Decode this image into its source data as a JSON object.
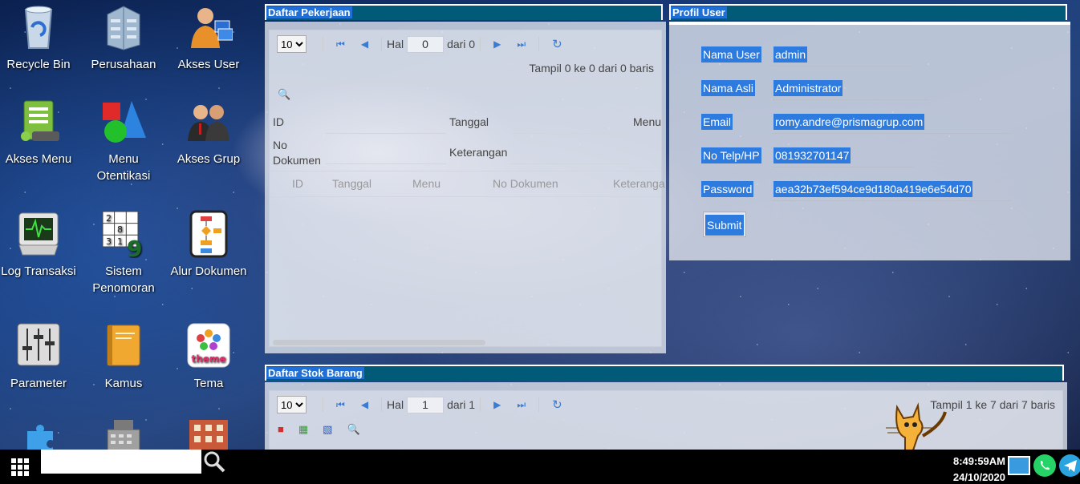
{
  "desktop": {
    "icons": [
      {
        "label": "Recycle Bin",
        "icon": "recycle-bin-icon"
      },
      {
        "label": "Perusahaan",
        "icon": "building-icon"
      },
      {
        "label": "Akses User",
        "icon": "user-access-icon"
      },
      {
        "label": "Akses Menu",
        "icon": "menu-access-icon"
      },
      {
        "label": "Menu Otentikasi",
        "icon": "shapes-icon"
      },
      {
        "label": "Akses Grup",
        "icon": "group-icon"
      },
      {
        "label": "Log Transaksi",
        "icon": "heartbeat-log-icon"
      },
      {
        "label": "Sistem Penomoran",
        "icon": "sudoku-numbering-icon"
      },
      {
        "label": "Alur Dokumen",
        "icon": "flowchart-icon"
      },
      {
        "label": "Parameter",
        "icon": "sliders-icon"
      },
      {
        "label": "Kamus",
        "icon": "book-icon"
      },
      {
        "label": "Tema",
        "icon": "theme-icon"
      }
    ],
    "theme_icon_text": "theme"
  },
  "work_list": {
    "title": "Daftar Pekerjaan",
    "page_size": "10",
    "hal_label": "Hal",
    "page_value": "0",
    "of_label": "dari 0",
    "summary": "Tampil 0 ke 0 dari 0 baris",
    "filter": {
      "id_label": "ID",
      "tanggal_label": "Tanggal",
      "menu_label": "Menu",
      "no_label": "No",
      "dokumen_label": "Dokumen",
      "keterangan_label": "Keterangan"
    },
    "columns": [
      "ID",
      "Tanggal",
      "Menu",
      "No Dokumen",
      "Keteranga"
    ]
  },
  "profile": {
    "title": "Profil User",
    "fields": [
      {
        "label": "Nama User",
        "value": "admin"
      },
      {
        "label": "Nama Asli",
        "value": "Administrator"
      },
      {
        "label": "Email",
        "value": "romy.andre@prismagrup.com"
      },
      {
        "label": "No Telp/HP",
        "value": "081932701147"
      },
      {
        "label": "Password",
        "value": "aea32b73ef594ce9d180a419e6e54d70"
      }
    ],
    "submit_label": "Submit"
  },
  "stock_list": {
    "title": "Daftar Stok Barang",
    "page_size": "10",
    "hal_label": "Hal",
    "page_value": "1",
    "of_label": "dari 1",
    "summary": "Tampil 1 ke 7 dari 7 baris"
  },
  "taskbar": {
    "search_placeholder": "",
    "time": "8:49:59AM",
    "date": "24/10/2020"
  }
}
